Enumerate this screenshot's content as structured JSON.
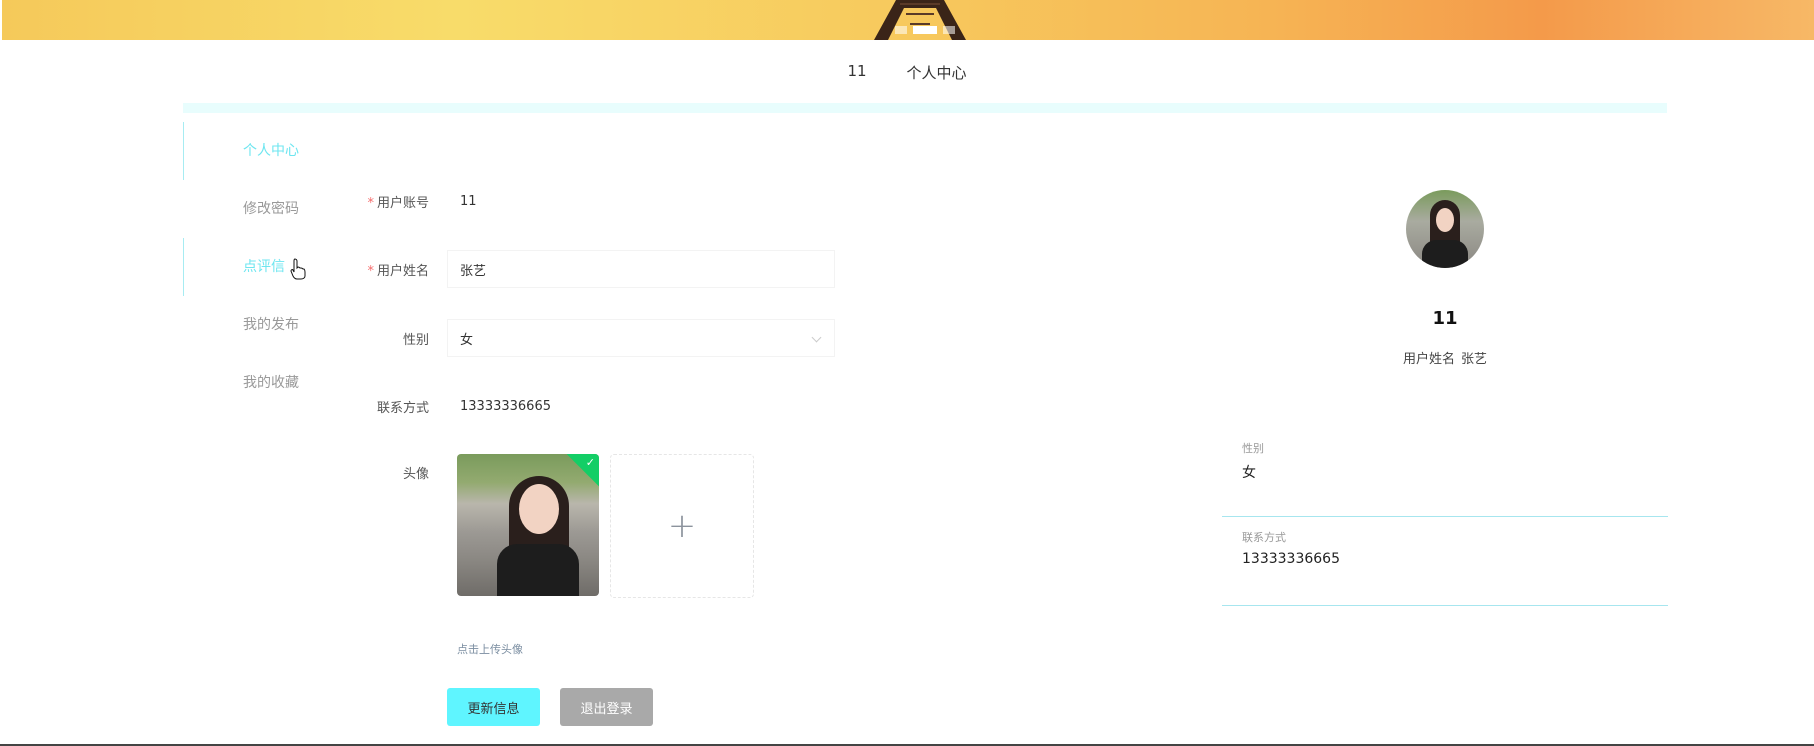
{
  "topnav": {
    "user_id": "11",
    "center_label": "个人中心"
  },
  "sidebar": {
    "items": [
      {
        "label": "个人中心"
      },
      {
        "label": "修改密码"
      },
      {
        "label": "点评信"
      },
      {
        "label": "我的发布"
      },
      {
        "label": "我的收藏"
      }
    ]
  },
  "form": {
    "account_label": "用户账号",
    "account_value": "11",
    "name_label": "用户姓名",
    "name_value": "张艺",
    "gender_label": "性别",
    "gender_value": "女",
    "contact_label": "联系方式",
    "contact_value": "13333336665",
    "avatar_label": "头像",
    "upload_plus": "+",
    "upload_tip": "点击上传头像",
    "update_button": "更新信息",
    "logout_button": "退出登录",
    "required_mark": "*",
    "check_mark": "✓"
  },
  "profile": {
    "name": "11",
    "sub_label": "用户姓名",
    "sub_value": "张艺",
    "gender_label": "性别",
    "gender_value": "女",
    "contact_label": "联系方式",
    "contact_value": "13333336665"
  },
  "colors": {
    "accent": "#5ff5ff",
    "active_text": "#6ee6f0",
    "required": "#f56c6c",
    "success": "#13ce66"
  },
  "icons": {
    "dropdown": "chevron-down-icon",
    "upload": "plus-icon",
    "uploaded": "check-icon",
    "cursor": "hand-cursor-icon"
  }
}
